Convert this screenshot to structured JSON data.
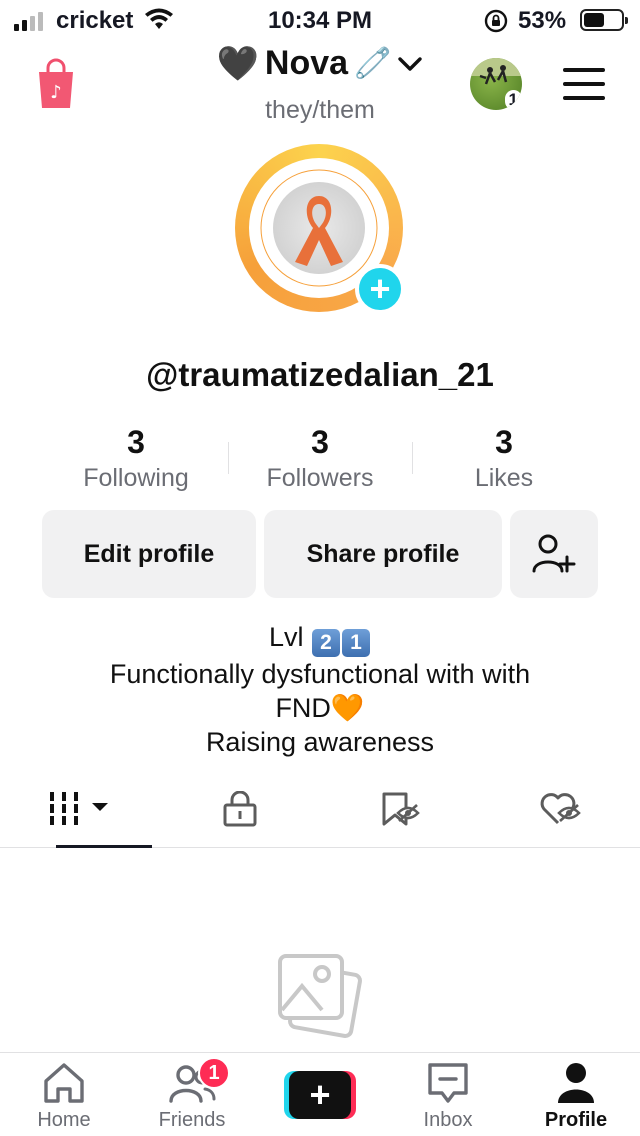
{
  "status_bar": {
    "carrier": "cricket",
    "time": "10:34 PM",
    "battery_percent": "53%"
  },
  "header": {
    "title_emoji_left": "🖤",
    "title_name": "Nova",
    "title_emoji_right": "🧷",
    "pronouns": "they/them",
    "account_badge_count": "1"
  },
  "profile": {
    "username": "@traumatizedalian_21",
    "stats": [
      {
        "value": "3",
        "label": "Following"
      },
      {
        "value": "3",
        "label": "Followers"
      },
      {
        "value": "3",
        "label": "Likes"
      }
    ],
    "edit_label": "Edit profile",
    "share_label": "Share profile",
    "bio_level_prefix": "Lvl",
    "bio_level_digits": [
      "2",
      "1"
    ],
    "bio_line2": "Functionally dysfunctional with with",
    "bio_line3": "FND🧡",
    "bio_line4": "Raising awareness"
  },
  "tabs": [
    "videos",
    "private",
    "reposts-hidden",
    "liked-hidden"
  ],
  "bottom_nav": {
    "home": "Home",
    "friends": "Friends",
    "friends_badge": "1",
    "inbox": "Inbox",
    "profile": "Profile"
  },
  "colors": {
    "accent_cyan": "#20d5ec",
    "accent_red": "#fe2c55",
    "text_primary": "#161823",
    "text_secondary": "#6b6d74"
  }
}
